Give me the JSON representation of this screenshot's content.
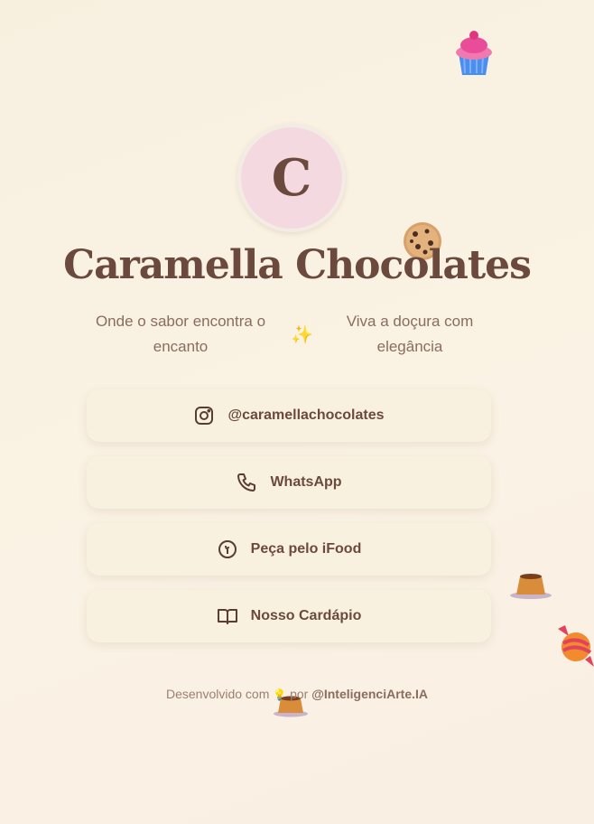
{
  "profile": {
    "avatar_letter": "C",
    "title": "Caramella Chocolates",
    "tagline_left": "Onde o sabor encontra o encanto",
    "tagline_separator": "✨",
    "tagline_right": "Viva a doçura com elegância"
  },
  "links": [
    {
      "label": "@caramellachocolates",
      "icon": "instagram-icon"
    },
    {
      "label": "WhatsApp",
      "icon": "phone-icon"
    },
    {
      "label": "Peça pelo iFood",
      "icon": "ifood-icon"
    },
    {
      "label": "Nosso Cardápio",
      "icon": "book-icon"
    }
  ],
  "footer": {
    "prefix": "Desenvolvido com",
    "emoji": "💡",
    "middle": "por",
    "author": "@InteligenciArte.IA"
  },
  "decorations": [
    "cupcake",
    "cookie",
    "flan",
    "candy",
    "flan"
  ],
  "colors": {
    "background": "#f8f0df",
    "text": "#6b4a3d",
    "avatar": "#f5d9e1",
    "button": "#f9f1e0"
  }
}
